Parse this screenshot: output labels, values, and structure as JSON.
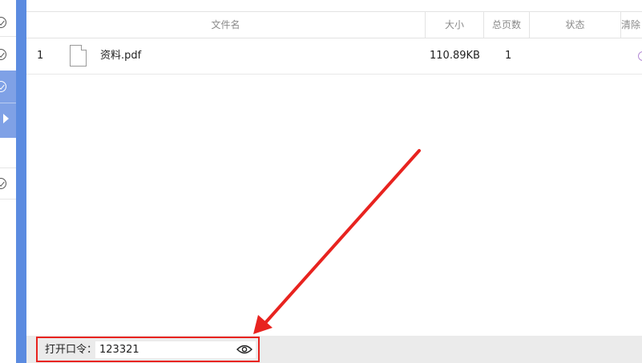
{
  "table": {
    "columns": {
      "filename": "文件名",
      "size": "大小",
      "pages": "总页数",
      "status": "状态",
      "clear": "清除"
    },
    "rows": [
      {
        "index": "1",
        "name": "资料.pdf",
        "size": "110.89KB",
        "pages": "1",
        "status": ""
      }
    ]
  },
  "password": {
    "label": "打开口令：",
    "value": "123321"
  },
  "colors": {
    "accent_blue": "#5b8be0",
    "annotation_red": "#e8231f"
  },
  "icons": [
    "check-circle-icon",
    "play-caret-icon",
    "pdf-file-icon",
    "eye-icon",
    "red-annotation-arrow"
  ]
}
